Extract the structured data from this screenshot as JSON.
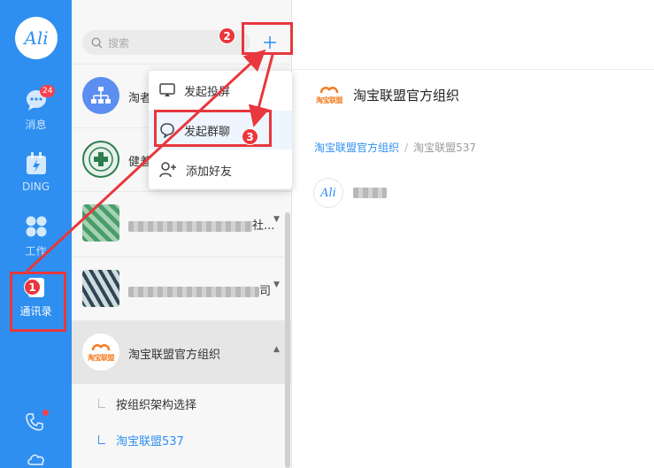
{
  "rail": {
    "logo": "Ali",
    "messages_label": "消息",
    "messages_badge": "24",
    "ding_label": "DING",
    "work_label": "工作",
    "contacts_label": "通讯录"
  },
  "search": {
    "placeholder": "搜索"
  },
  "contacts": {
    "row1_name": "淘者",
    "row2_name": "健着",
    "row3_suffix": "社...",
    "row4_suffix": "司",
    "org_name": "淘宝联盟官方组织",
    "org_logo_text": "淘宝联盟",
    "sub_by_structure": "按组织架构选择",
    "sub_dept": "淘宝联盟537"
  },
  "menu": {
    "item_share_screen": "发起投屏",
    "item_group_chat": "发起群聊",
    "item_add_friend": "添加好友"
  },
  "detail": {
    "org_title": "淘宝联盟官方组织",
    "breadcrumb_root": "淘宝联盟官方组织",
    "breadcrumb_sep": "/",
    "breadcrumb_current": "淘宝联盟537",
    "member_avatar": "Ali"
  },
  "annotations": {
    "step1": "1",
    "step2": "2",
    "step3": "3"
  },
  "colors": {
    "rail_blue": "#2f8ff0",
    "annotation_red": "#e8373d",
    "taobao_orange": "#f47b20"
  }
}
